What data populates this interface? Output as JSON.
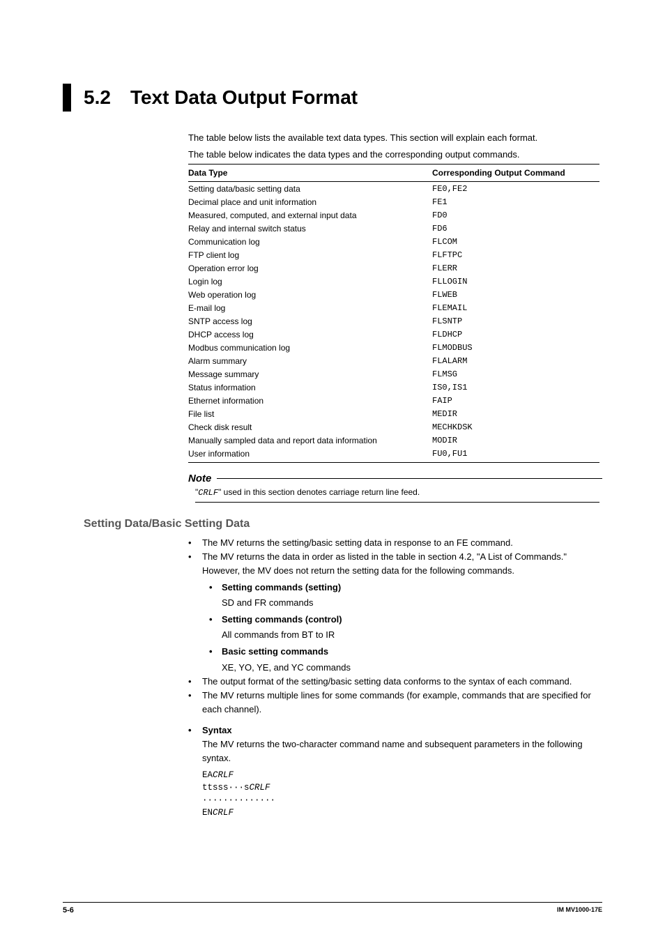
{
  "header": {
    "section_number": "5.2",
    "section_title": "Text Data Output Format"
  },
  "intro_line1": "The table below lists the available text data types. This section will explain each format.",
  "intro_line2": "The table below indicates the data types and the corresponding output commands.",
  "table": {
    "col1": "Data Type",
    "col2": "Corresponding Output Command",
    "rows": [
      {
        "type": "Setting data/basic setting data",
        "cmd": "FE0,FE2"
      },
      {
        "type": "Decimal place and unit information",
        "cmd": "FE1"
      },
      {
        "type": "Measured, computed, and external input data",
        "cmd": "FD0"
      },
      {
        "type": "Relay and internal switch status",
        "cmd": "FD6"
      },
      {
        "type": "Communication log",
        "cmd": "FLCOM"
      },
      {
        "type": "FTP client log",
        "cmd": "FLFTPC"
      },
      {
        "type": "Operation error log",
        "cmd": "FLERR"
      },
      {
        "type": "Login log",
        "cmd": "FLLOGIN"
      },
      {
        "type": "Web operation log",
        "cmd": "FLWEB"
      },
      {
        "type": "E-mail log",
        "cmd": "FLEMAIL"
      },
      {
        "type": "SNTP access log",
        "cmd": "FLSNTP"
      },
      {
        "type": "DHCP access log",
        "cmd": "FLDHCP"
      },
      {
        "type": "Modbus communication log",
        "cmd": "FLMODBUS"
      },
      {
        "type": "Alarm summary",
        "cmd": "FLALARM"
      },
      {
        "type": "Message summary",
        "cmd": "FLMSG"
      },
      {
        "type": "Status information",
        "cmd": "IS0,IS1"
      },
      {
        "type": "Ethernet information",
        "cmd": "FAIP"
      },
      {
        "type": "File list",
        "cmd": "MEDIR"
      },
      {
        "type": "Check disk result",
        "cmd": "MECHKDSK"
      },
      {
        "type": "Manually sampled data and report data information",
        "cmd": "MODIR"
      },
      {
        "type": "User information",
        "cmd": "FU0,FU1"
      }
    ]
  },
  "note": {
    "title": "Note",
    "code": "CRLF",
    "text_prefix": "\"",
    "text_suffix": "\" used in this section denotes carriage return line feed."
  },
  "sub_heading": "Setting Data/Basic Setting Data",
  "bullets": {
    "b1": "The MV returns the setting/basic setting data in response to an FE command.",
    "b2": "The MV returns the data in order as listed in the table in section 4.2, \"A List of Commands.\" However, the MV does not return the setting data for the following commands.",
    "sub1_title": "Setting commands (setting)",
    "sub1_desc": "SD and FR commands",
    "sub2_title": "Setting commands (control)",
    "sub2_desc": "All commands from BT to IR",
    "sub3_title": "Basic setting commands",
    "sub3_desc": "XE, YO, YE, and YC commands",
    "b3": "The output format of the setting/basic setting data conforms to the syntax of each command.",
    "b4": "The MV returns multiple lines for some commands (for example, commands that are specified for each channel).",
    "syntax_title": "Syntax",
    "syntax_desc": "The MV returns the two-character command name and subsequent parameters in the following syntax.",
    "syntax_l1_a": "EA",
    "syntax_l1_b": "CRLF",
    "syntax_l2_a": "ttsss···s",
    "syntax_l2_b": "CRLF",
    "syntax_l3": "··············",
    "syntax_l4_a": "EN",
    "syntax_l4_b": "CRLF"
  },
  "footer": {
    "page": "5-6",
    "doc": "IM MV1000-17E"
  }
}
